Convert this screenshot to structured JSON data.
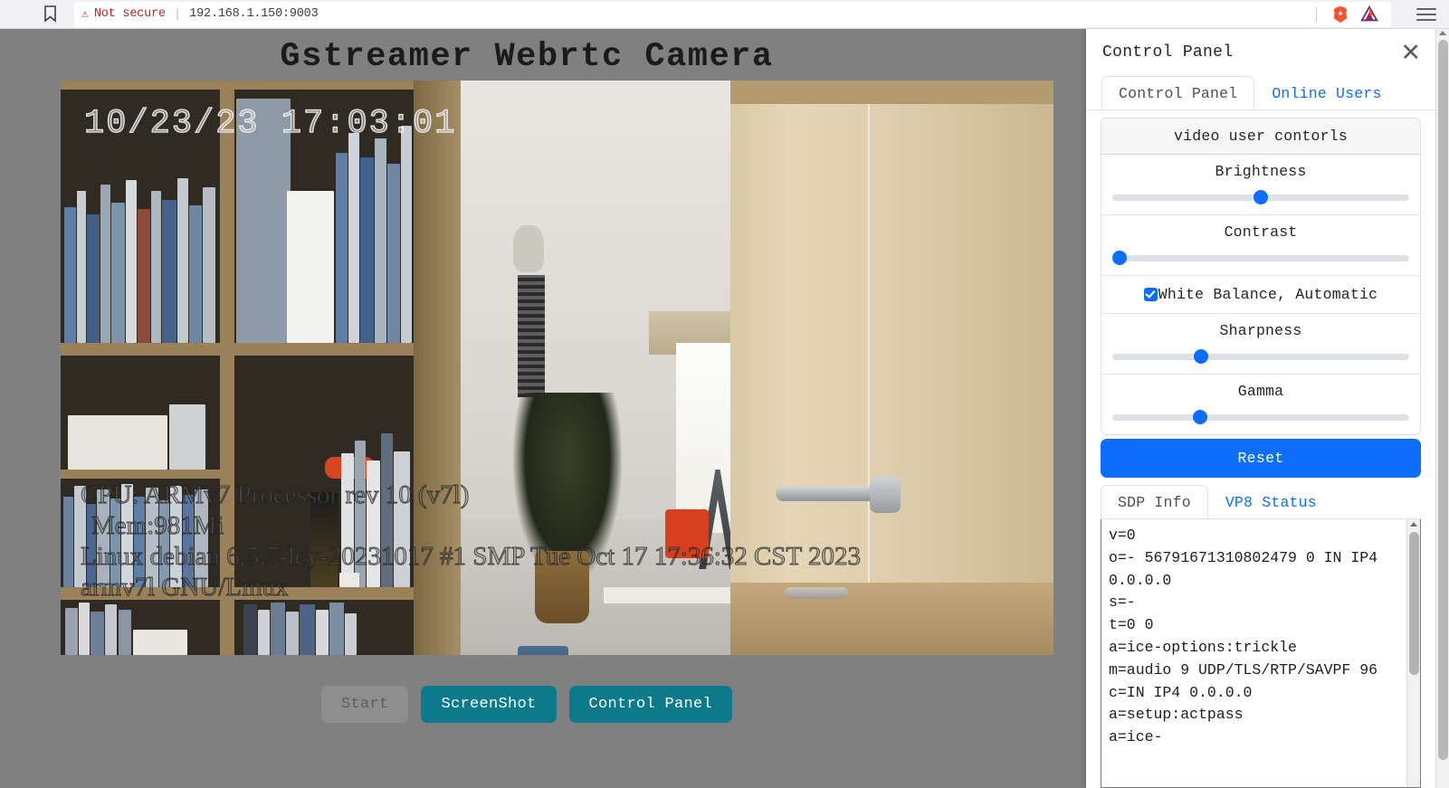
{
  "browser": {
    "bookmark_icon": "bookmark-icon",
    "security_warning_icon": "warning-triangle-icon",
    "security_label": "Not secure",
    "url": "192.168.1.150:9003",
    "brave_shield_icon": "brave-lion-icon",
    "brave_rewards_icon": "brave-bat-triangle-icon",
    "menu_icon": "hamburger-menu-icon"
  },
  "page": {
    "title": "Gstreamer Webrtc Camera",
    "background_color": "#808080"
  },
  "video": {
    "timestamp_overlay": "10/23/23 17:03:01",
    "system_overlay": [
      "CPU: ARMv7 Processor rev 10 (v7l)",
      "Mem:981Mi",
      "Linux debian 6.5.7-lcy-20231017 #1 SMP Tue Oct 17 17:36:32 CST 2023",
      "armv7l GNU/Linux"
    ]
  },
  "buttons": {
    "start": "Start",
    "screenshot": "ScreenShot",
    "control_panel": "Control Panel",
    "teal_color": "#0d7a8c"
  },
  "control_panel": {
    "title": "Control Panel",
    "close_icon": "close-x-icon",
    "tabs": [
      {
        "label": "Control Panel",
        "active": true
      },
      {
        "label": "Online Users",
        "active": false
      }
    ],
    "card_title": "video user contorls",
    "accent_color": "#0d6efd",
    "controls": [
      {
        "label": "Brightness",
        "value": 50
      },
      {
        "label": "Contrast",
        "value": 2
      },
      {
        "label": "Sharpness",
        "value": 30
      },
      {
        "label": "Gamma",
        "value": 29
      }
    ],
    "checkbox": {
      "label": "White Balance, Automatic",
      "checked": true
    },
    "reset_label": "Reset",
    "sdp_tabs": [
      {
        "label": "SDP Info",
        "active": true
      },
      {
        "label": "VP8 Status",
        "active": false
      }
    ],
    "sdp_text": "v=0\no=- 56791671310802479 0 IN IP4 0.0.0.0\ns=-\nt=0 0\na=ice-options:trickle\nm=audio 9 UDP/TLS/RTP/SAVPF 96\nc=IN IP4 0.0.0.0\na=setup:actpass\na=ice-"
  }
}
